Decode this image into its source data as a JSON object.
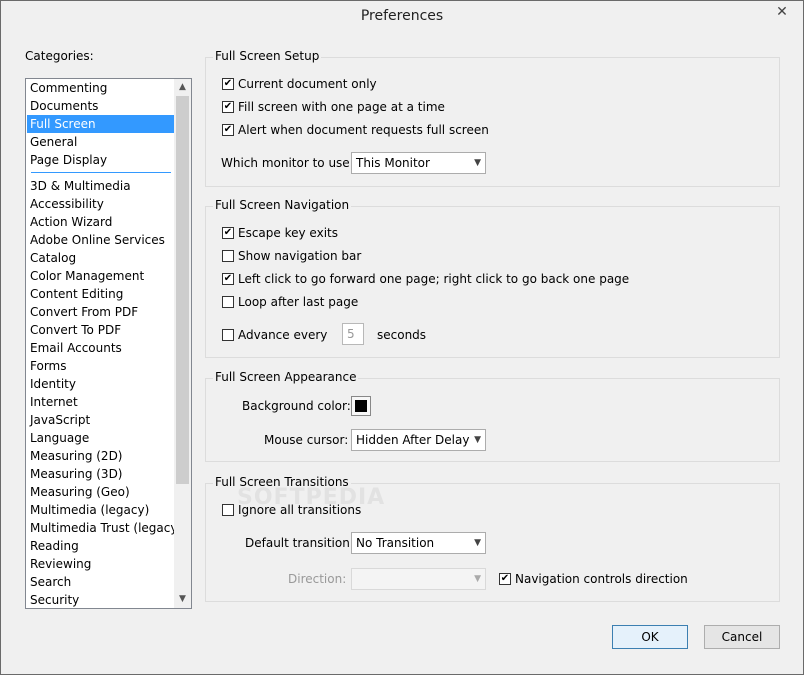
{
  "window": {
    "title": "Preferences",
    "close_glyph": "✕"
  },
  "categories": {
    "label": "Categories:",
    "top_items": [
      "Commenting",
      "Documents",
      "Full Screen",
      "General",
      "Page Display"
    ],
    "selected": "Full Screen",
    "items": [
      "3D & Multimedia",
      "Accessibility",
      "Action Wizard",
      "Adobe Online Services",
      "Catalog",
      "Color Management",
      "Content Editing",
      "Convert From PDF",
      "Convert To PDF",
      "Email Accounts",
      "Forms",
      "Identity",
      "Internet",
      "JavaScript",
      "Language",
      "Measuring (2D)",
      "Measuring (3D)",
      "Measuring (Geo)",
      "Multimedia (legacy)",
      "Multimedia Trust (legacy)",
      "Reading",
      "Reviewing",
      "Search",
      "Security"
    ]
  },
  "setup": {
    "title": "Full Screen Setup",
    "current_doc_only": "Current document only",
    "fill_screen": "Fill screen with one page at a time",
    "alert_request": "Alert when document requests full screen",
    "monitor_label": "Which monitor to use:",
    "monitor_value": "This Monitor"
  },
  "navigation": {
    "title": "Full Screen Navigation",
    "escape_exits": "Escape key exits",
    "show_nav_bar": "Show navigation bar",
    "left_click": "Left click to go forward one page; right click to go back one page",
    "loop_after_last": "Loop after last page",
    "advance_every": "Advance every",
    "advance_value": "5",
    "seconds": "seconds"
  },
  "appearance": {
    "title": "Full Screen Appearance",
    "background_label": "Background color:",
    "background_color": "#000000",
    "cursor_label": "Mouse cursor:",
    "cursor_value": "Hidden After Delay"
  },
  "transitions": {
    "title": "Full Screen Transitions",
    "ignore_all": "Ignore all transitions",
    "default_label": "Default transition:",
    "default_value": "No Transition",
    "direction_label": "Direction:",
    "direction_value": "",
    "nav_controls_direction": "Navigation controls direction"
  },
  "watermark": "SOFTPEDIA",
  "buttons": {
    "ok": "OK",
    "cancel": "Cancel"
  },
  "glyphs": {
    "check": "✔",
    "down": "▼",
    "up": "▲"
  }
}
